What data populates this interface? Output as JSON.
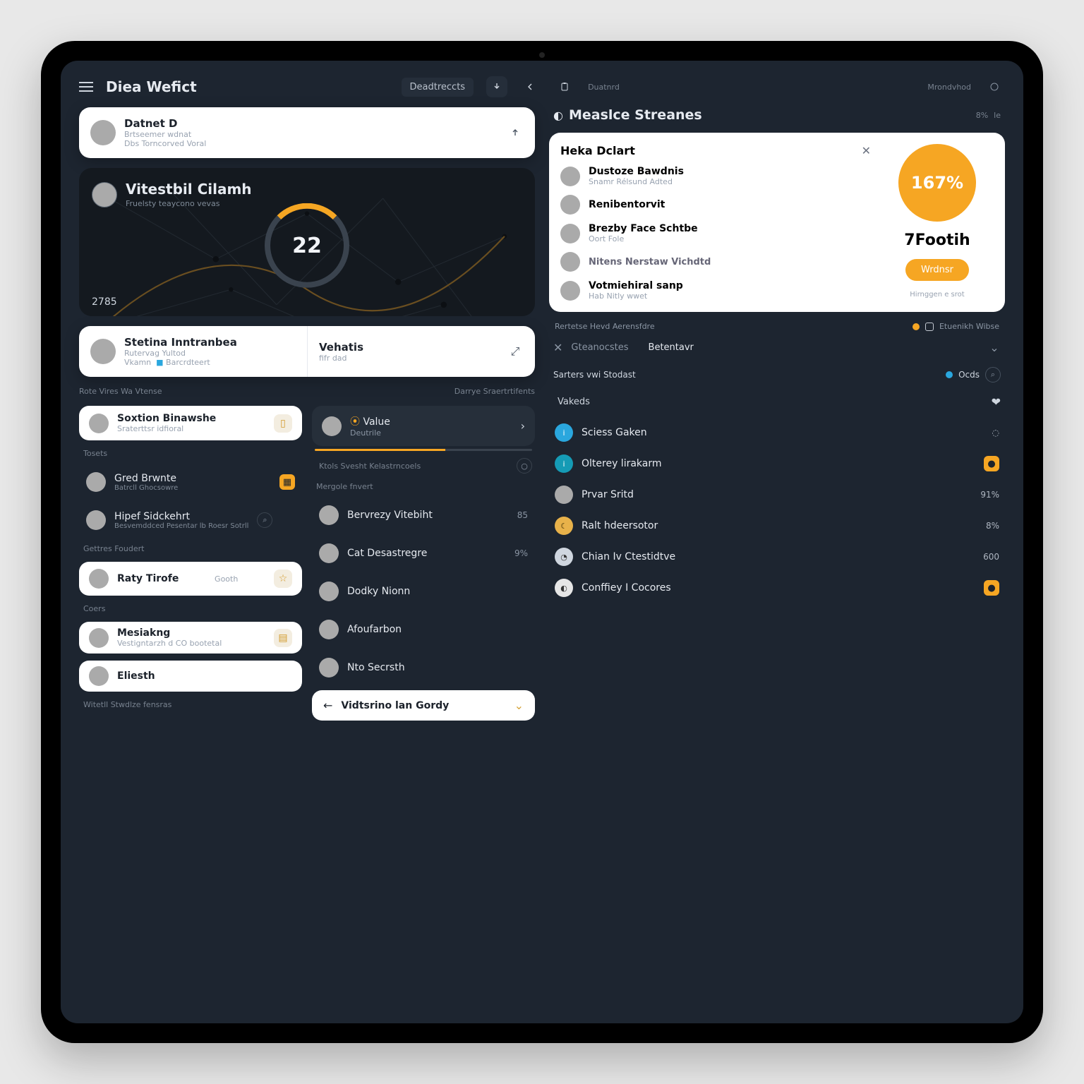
{
  "topbar": {
    "brand": "Diea Wefict",
    "chip1": "Deadtreccts",
    "chip2": "Duatnrd",
    "right": "Mrondvhod"
  },
  "profileCard": {
    "name": "Datnet D",
    "line1": "Brtseemer wdnat",
    "line2": "Dbs Torncorved Voral"
  },
  "mapCard": {
    "title": "Vitestbil Cilamh",
    "sub": "Fruelsty teaycono vevas",
    "big": "22",
    "corner": "2785"
  },
  "splitLeft": {
    "title": "Stetina Inntranbea",
    "sub": "Rutervag Yultod",
    "beltag": "Vkamn",
    "tag": "Barcrdteert"
  },
  "splitRight": {
    "title": "Vehatis",
    "sub": "fifr dad"
  },
  "leftHeader1": "Rote Vires Wa Vtense",
  "leftHeader2": "Darrye Sraertrtifents",
  "l1": {
    "name": "Soxtion Binawshe",
    "sub": "Sraterttsr idfioral"
  },
  "ltTosets": "Tosets",
  "l2": {
    "name": "Gred Brwnte",
    "sub": "Batrcll Ghocsowre"
  },
  "l3": {
    "name": "Hipef Sidckehrt",
    "sub": "Besvemddced Pesentar lb Roesr Sotrll"
  },
  "ltGettres": "Gettres Foudert",
  "l4": {
    "name": "Raty Tirofe",
    "right": "Gooth"
  },
  "ltCoers": "Coers",
  "l5": {
    "name": "Mesiakng",
    "sub": "Vestigntarzh d CO bootetal"
  },
  "l6": {
    "name": "Eliesth"
  },
  "foot": "Witetll Stwdlze fensras",
  "midTile": {
    "name": "Value",
    "sub": "Deutrile"
  },
  "midLabel": "Ktols Svesht Kelastrncoels",
  "midSub": "Mergole fnvert",
  "mid": [
    {
      "name": "Bervrezy Vitebiht",
      "val": "85"
    },
    {
      "name": "Cat Desastregre",
      "val": "9%"
    },
    {
      "name": "Dodky Nionn",
      "val": ""
    },
    {
      "name": "Afoufarbon",
      "val": ""
    },
    {
      "name": "Nto Secrsth",
      "val": ""
    }
  ],
  "midBtn": "Vidtsrino lan Gordy",
  "rHeader": {
    "title": "Measlce Streanes",
    "r1": "8%",
    "r2": "le"
  },
  "panel": {
    "title": "Heka Dclart",
    "items": [
      {
        "name": "Dustoze Bawdnis",
        "sub": "Snamr Rélsund Adted"
      },
      {
        "name": "Renibentorvit",
        "sub": ""
      },
      {
        "name": "Brezby Face Schtbe",
        "sub": "Oort Fole"
      },
      {
        "name": "Nitens Nerstaw Vichdtd",
        "sub": ""
      },
      {
        "name": "Votmiehiral sanp",
        "sub": "Hab Nitly wwet"
      }
    ],
    "pct": "167%",
    "big2": "7Footih",
    "btn": "Wrdnsr",
    "note": "Hirnggen e srot",
    "footL": "Rertetse Hevd Aerensfdre",
    "footR": "Etuenikh Wibse"
  },
  "tabs": {
    "a": "Gteanocstes",
    "b": "Betentavr"
  },
  "subbar": {
    "label": "Sarters vwi Stodast",
    "right": "Ocds"
  },
  "rLabel": "Vakeds",
  "rlist": [
    {
      "c": "#2aa7de",
      "name": "Sciess Gaken",
      "val": ""
    },
    {
      "c": "#159bb5",
      "name": "Olterey lirakarm",
      "val": ""
    },
    {
      "c": "#888",
      "name": "Prvar Sritd",
      "val": "91%"
    },
    {
      "c": "#e8b24a",
      "name": "Ralt hdeersotor",
      "val": "8%"
    },
    {
      "c": "#bdbdbd",
      "name": "Chian Iv Ctestidtve",
      "val": "600"
    },
    {
      "c": "#e6e6e6",
      "name": "Conffiey I Cocores",
      "val": ""
    }
  ]
}
